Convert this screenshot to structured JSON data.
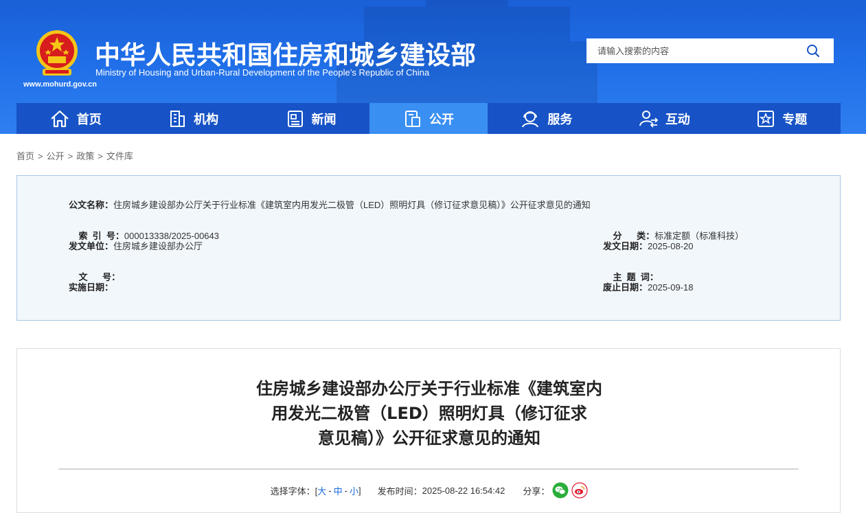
{
  "header": {
    "title": "中华人民共和国住房和城乡建设部",
    "subtitle": "Ministry of Housing and Urban-Rural Development of the People’s Republic of China",
    "url": "www.mohurd.gov.cn",
    "search_placeholder": "请输入搜索的内容"
  },
  "nav": [
    {
      "label": "首页",
      "icon": "home-icon"
    },
    {
      "label": "机构",
      "icon": "building-icon"
    },
    {
      "label": "新闻",
      "icon": "news-icon"
    },
    {
      "label": "公开",
      "icon": "document-icon",
      "active": true
    },
    {
      "label": "服务",
      "icon": "service-icon"
    },
    {
      "label": "互动",
      "icon": "interact-icon"
    },
    {
      "label": "专题",
      "icon": "star-icon"
    }
  ],
  "breadcrumb": [
    "首页",
    "公开",
    "政策",
    "文件库"
  ],
  "meta": {
    "doc_name_label": "公文名称：",
    "doc_name": "住房城乡建设部办公厅关于行业标准《建筑室内用发光二极管（LED）照明灯具（修订征求意见稿）》公开征求意见的通知",
    "index_label": "索  引  号：",
    "index": "000013338/2025-00643",
    "category_label": "分      类：",
    "category": "标准定额（标准科技）",
    "issuer_label": "发文单位：",
    "issuer": "住房城乡建设部办公厅",
    "issue_date_label": "发文日期：",
    "issue_date": "2025-08-20",
    "doc_no_label": "文      号：",
    "doc_no": "",
    "keywords_label": "主  题  词：",
    "keywords": "",
    "effective_label": "实施日期：",
    "effective": "",
    "expiry_label": "废止日期：",
    "expiry": "2025-09-18"
  },
  "article": {
    "title_line1": "住房城乡建设部办公厅关于行业标准《建筑室内",
    "title_line2": "用发光二极管（LED）照明灯具（修订征求",
    "title_line3": "意见稿）》公开征求意见的通知",
    "font_label": "选择字体：[",
    "font_large": "大",
    "font_medium": "中",
    "font_small": "小",
    "font_close": "]",
    "dash": "-",
    "publish_label": "发布时间：",
    "publish_time": "2025-08-22 16:54:42",
    "share_label": "分享："
  },
  "colors": {
    "header_blue": "#1f6ee8",
    "nav_blue": "#1753c6",
    "nav_active": "#3a8ff2",
    "wechat": "#2aae3a",
    "weibo": "#e6162d"
  }
}
